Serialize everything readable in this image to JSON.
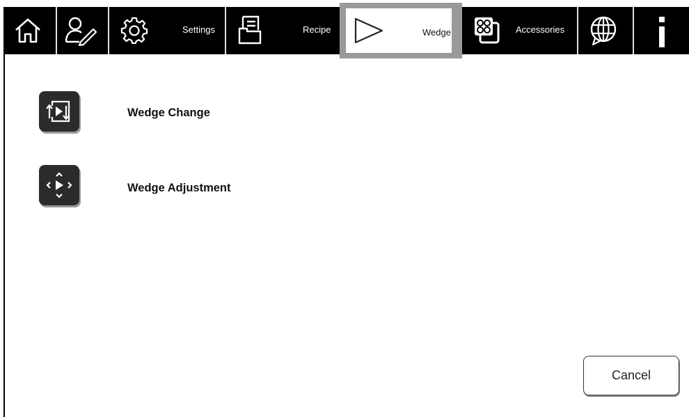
{
  "toolbar": {
    "items": [
      {
        "icon": "home-icon"
      },
      {
        "icon": "user-edit-icon"
      },
      {
        "icon": "gear-icon",
        "label": "Settings"
      },
      {
        "icon": "recipe-icon",
        "label": "Recipe"
      },
      {
        "icon": "wedge-icon",
        "label": "Wedge",
        "active": true
      },
      {
        "icon": "accessories-icon",
        "label": "Accessories"
      },
      {
        "icon": "globe-icon"
      },
      {
        "icon": "info-icon"
      }
    ],
    "bar_color": "#000000",
    "active_frame_color": "#9a9a9a"
  },
  "menu": {
    "items": [
      {
        "icon": "wedge-change-icon",
        "label": "Wedge Change"
      },
      {
        "icon": "wedge-adjustment-icon",
        "label": "Wedge Adjustment"
      }
    ]
  },
  "footer": {
    "cancel_label": "Cancel"
  }
}
